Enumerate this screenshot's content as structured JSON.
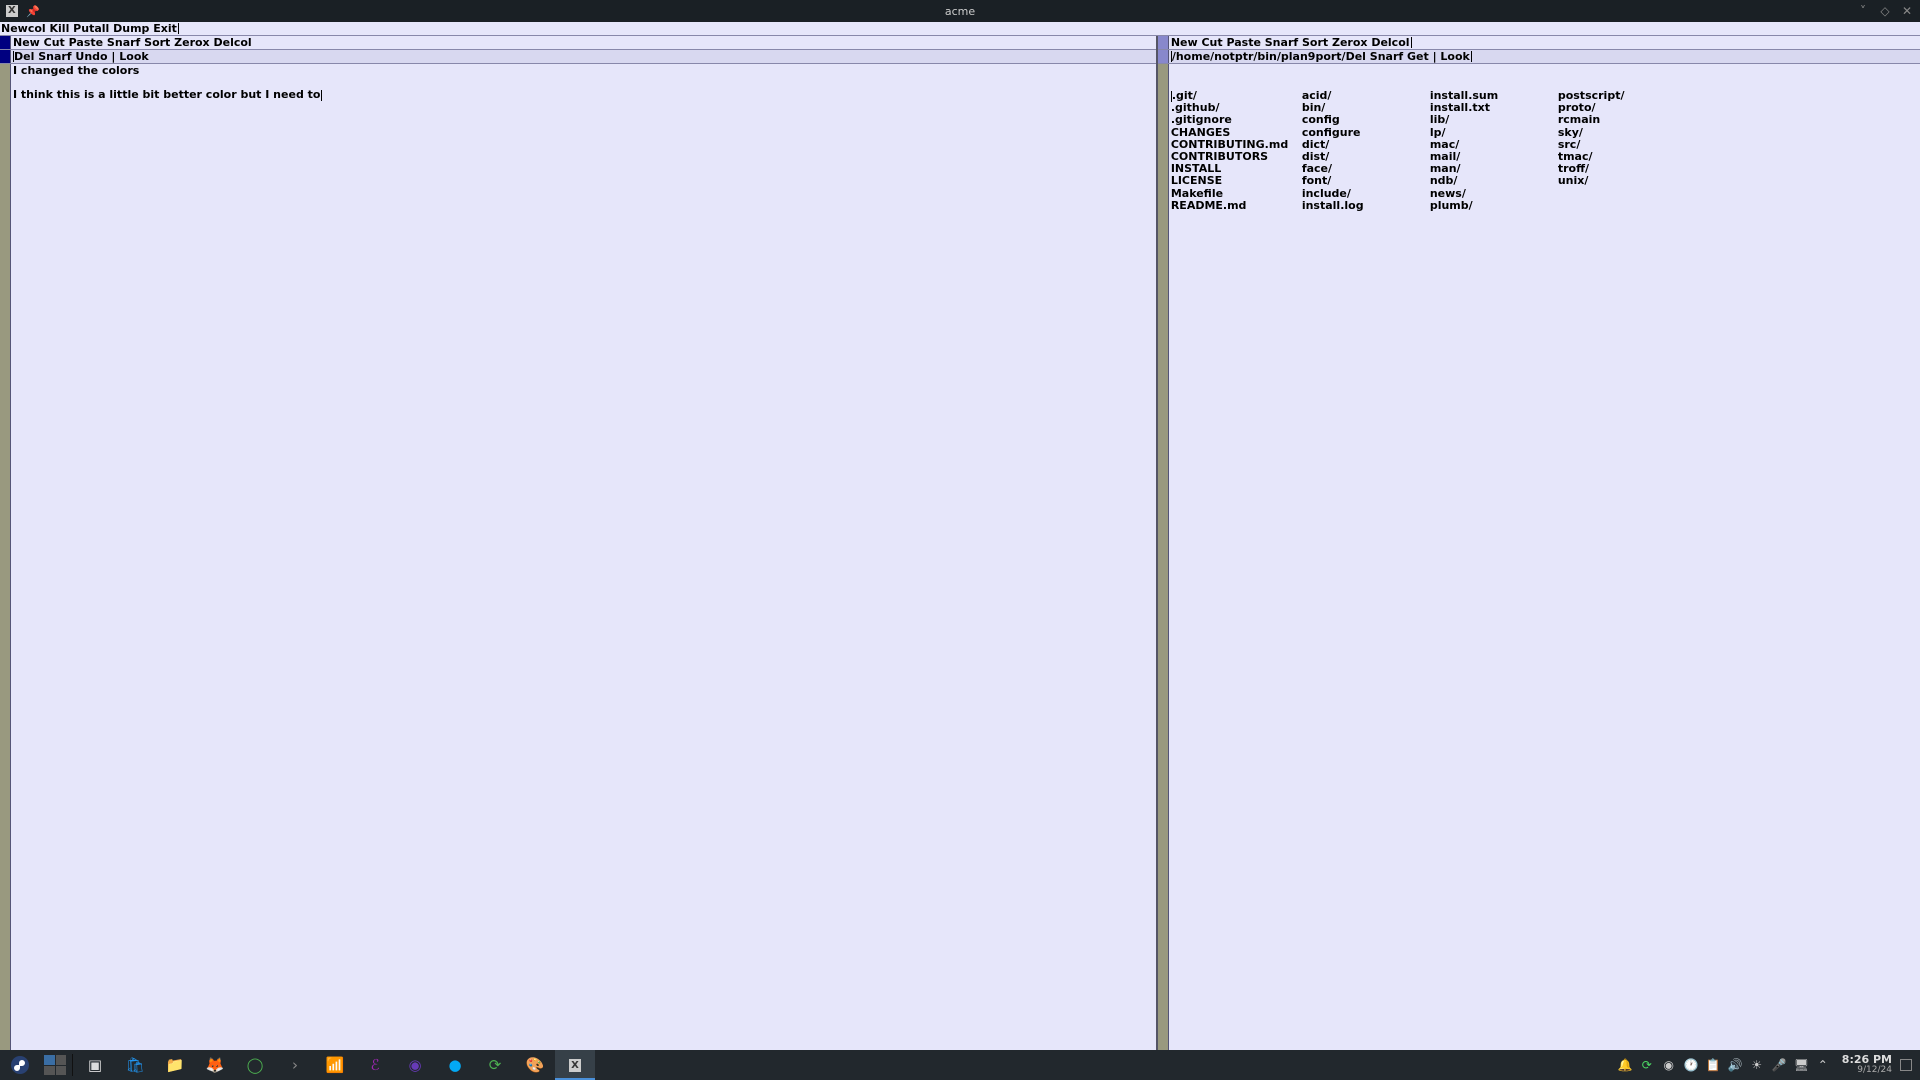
{
  "window": {
    "title": "acme"
  },
  "acme": {
    "row_tag": "Newcol Kill Putall Dump Exit",
    "col_left_tag": "New Cut Paste Snarf Sort Zerox Delcol",
    "col_right_tag": "New Cut Paste Snarf Sort Zerox Delcol",
    "left_win": {
      "tag": " Del Snarf Undo | Look",
      "body_line1": "I changed the colors",
      "body_line2": "",
      "body_line3": "I think this is a little bit better color but I need to"
    },
    "right_win": {
      "tag_path": "/home/notptr/bin/plan9port/",
      "tag_cmds": " Del Snarf Get | Look",
      "dir": {
        "c1": [
          ".git/",
          ".github/",
          ".gitignore",
          "CHANGES",
          "CONTRIBUTING.md",
          "CONTRIBUTORS",
          "INSTALL",
          "LICENSE",
          "Makefile",
          "README.md"
        ],
        "c2": [
          "acid/",
          "bin/",
          "config",
          "configure",
          "dict/",
          "dist/",
          "face/",
          "font/",
          "include/",
          "install.log"
        ],
        "c3": [
          "install.sum",
          "install.txt",
          "lib/",
          "lp/",
          "mac/",
          "mail/",
          "man/",
          "ndb/",
          "news/",
          "plumb/"
        ],
        "c4": [
          "postscript/",
          "proto/",
          "rcmain",
          "sky/",
          "src/",
          "tmac/",
          "troff/",
          "unix/"
        ]
      }
    }
  },
  "taskbar": {
    "clock_time": "8:26 PM",
    "clock_date": "9/12/24"
  },
  "colors": {
    "tag_bg": "#e6e6fa",
    "body_bg": "#e6e6fa",
    "titlebar_bg": "#1a2025",
    "taskbar_bg": "#22282d"
  }
}
